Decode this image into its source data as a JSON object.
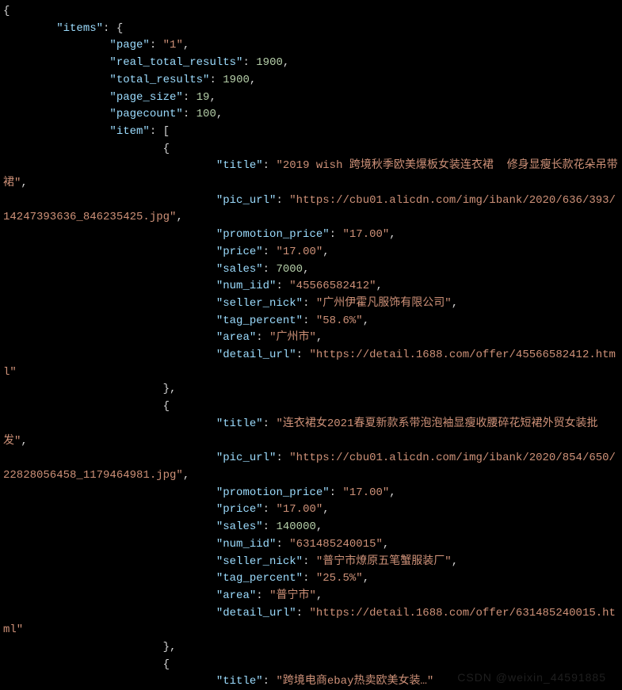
{
  "code_json": {
    "items": {
      "page": "1",
      "real_total_results": 1900,
      "total_results": 1900,
      "page_size": 19,
      "pagecount": 100,
      "item": [
        {
          "title": "2019 wish 跨境秋季欧美爆板女装连衣裙  修身显瘦长款花朵吊带裙",
          "pic_url": "https://cbu01.alicdn.com/img/ibank/2020/636/393/14247393636_846235425.jpg",
          "promotion_price": "17.00",
          "price": "17.00",
          "sales": 7000,
          "num_iid": "45566582412",
          "seller_nick": "广州伊霍凡服饰有限公司",
          "tag_percent": "58.6%",
          "area": "广州市",
          "detail_url": "https://detail.1688.com/offer/45566582412.html"
        },
        {
          "title": "连衣裙女2021春夏新款系带泡泡袖显瘦收腰碎花短裙外贸女装批发",
          "pic_url": "https://cbu01.alicdn.com/img/ibank/2020/854/650/22828056458_1179464981.jpg",
          "promotion_price": "17.00",
          "price": "17.00",
          "sales": 140000,
          "num_iid": "631485240015",
          "seller_nick": "普宁市燎原五笔蟹服装厂",
          "tag_percent": "25.5%",
          "area": "普宁市",
          "detail_url": "https://detail.1688.com/offer/631485240015.html"
        },
        {
          "title": "跨境电商ebay热卖欧美女装…"
        }
      ]
    }
  },
  "watermark": "CSDN @weixin_44591885",
  "indent": {
    "root": "",
    "items_key": "        ",
    "items_children": "                ",
    "item_open_brace": "                        ",
    "item_props": "                                "
  }
}
